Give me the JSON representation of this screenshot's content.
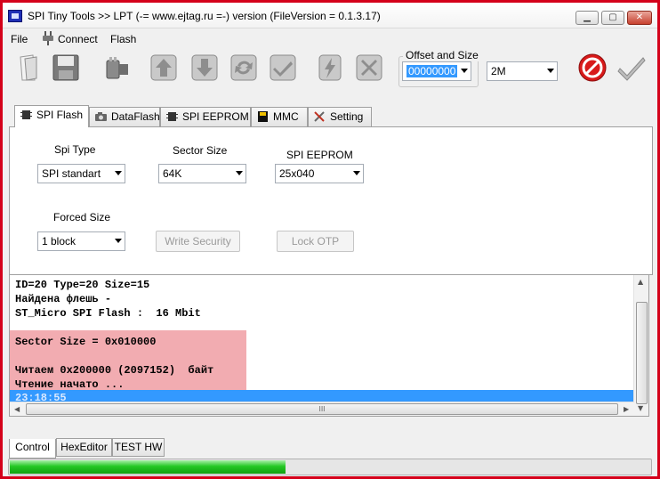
{
  "window": {
    "title": "SPI Tiny Tools >> LPT (-= www.ejtag.ru =-) version (FileVersion = 0.1.3.17)",
    "minimize": "▁",
    "maximize": "▢",
    "close": "✕"
  },
  "menu": {
    "file": "File",
    "connect": "Connect",
    "flash": "Flash"
  },
  "toolbar": {
    "offset_label": "Offset and Size",
    "offset_value": "00000000",
    "size_value": "2M"
  },
  "tabs": [
    {
      "label": "SPI Flash",
      "icon": "chip-icon"
    },
    {
      "label": "DataFlash",
      "icon": "camera-icon"
    },
    {
      "label": "SPI EEPROM",
      "icon": "chip-icon"
    },
    {
      "label": "MMC",
      "icon": "sd-card-icon"
    },
    {
      "label": "Setting",
      "icon": "tools-icon"
    }
  ],
  "spi_flash": {
    "spi_type_label": "Spi Type",
    "spi_type_value": "SPI standart",
    "sector_size_label": "Sector Size",
    "sector_size_value": "64K",
    "spi_eeprom_label": "SPI EEPROM",
    "spi_eeprom_value": "25x040",
    "forced_size_label": "Forced Size",
    "forced_size_value": "1 block",
    "write_security": "Write Security",
    "lock_otp": "Lock OTP"
  },
  "log": {
    "lines": [
      "ID=20 Type=20 Size=15",
      "Найдена флешь -",
      "ST_Micro SPI Flash :  16 Mbit",
      "",
      "Sector Size = 0x010000",
      "",
      "Читаем 0x200000 (2097152)  байт",
      "Чтение начато ...",
      "23:18:55"
    ],
    "hscroll_grip": "III"
  },
  "bottom_tabs": {
    "control": "Control",
    "hexeditor": "HexEditor",
    "test_hw": "TEST HW"
  },
  "progress": {
    "fraction": 0.43
  },
  "colors": {
    "window_border": "#d4001a",
    "selection": "#3399ff",
    "highlight_overlay": "#e65a64",
    "progress_fill": "#24c824"
  }
}
